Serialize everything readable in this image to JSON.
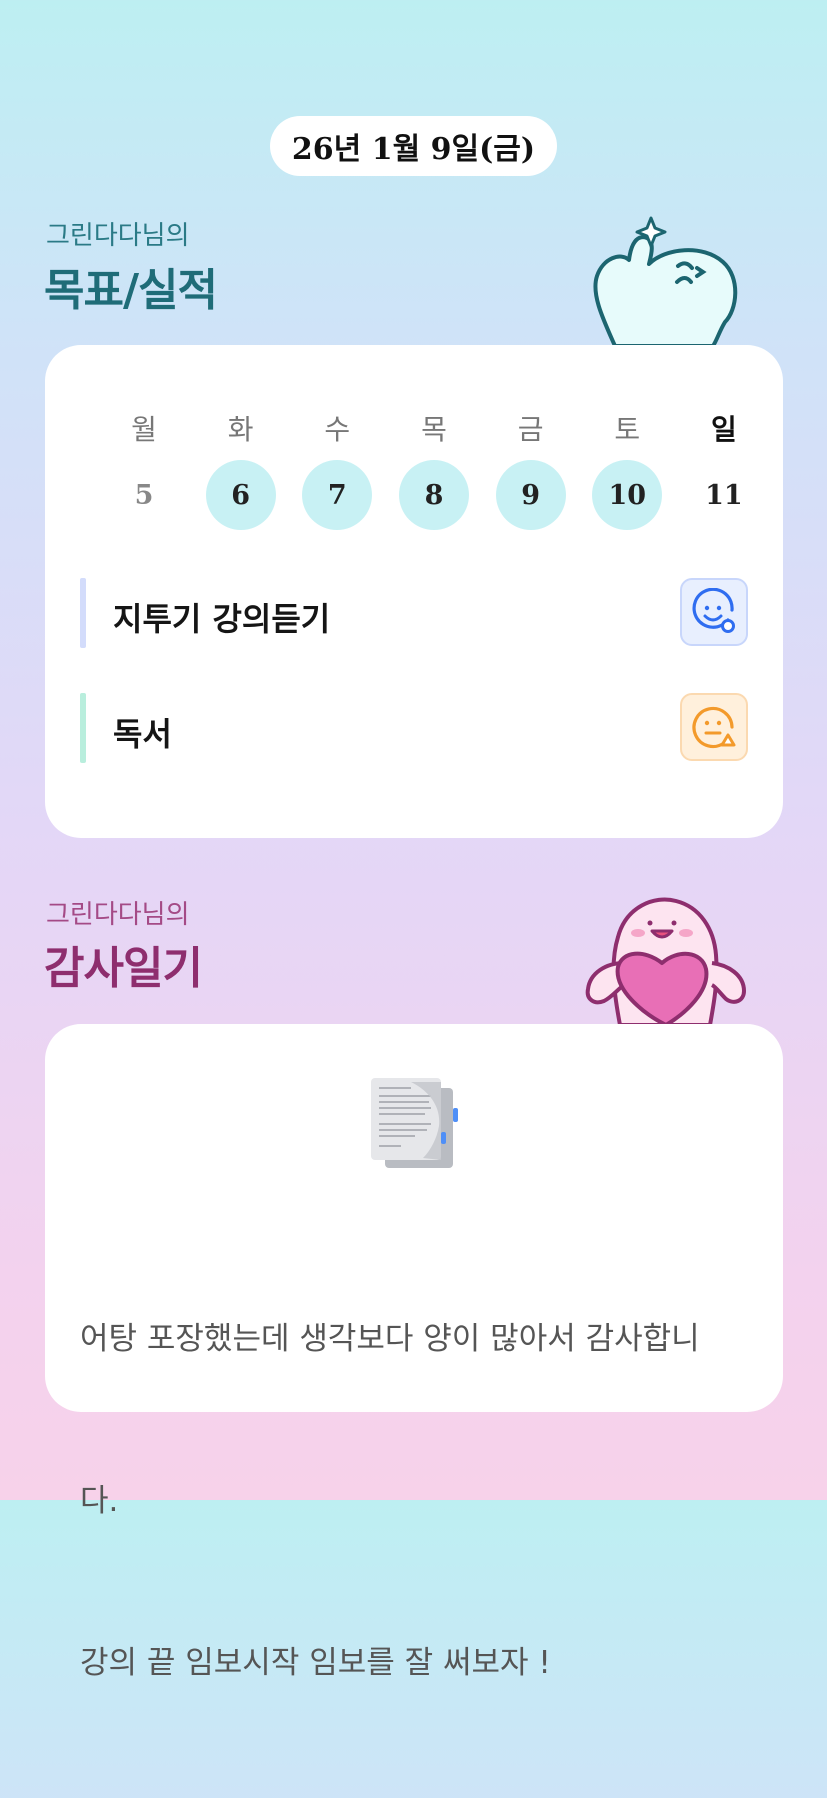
{
  "header": {
    "date": "26년 1월 9일(금)"
  },
  "goals_section": {
    "subtitle": "그린다다님의",
    "title": "목표/실적",
    "weekdays": [
      "월",
      "화",
      "수",
      "목",
      "금",
      "토",
      "일"
    ],
    "dates": [
      "5",
      "6",
      "7",
      "8",
      "9",
      "10",
      "11"
    ],
    "items": [
      {
        "label": "지투기 강의듣기",
        "status_icon": "smile-face-circle-icon",
        "accent": "#d3dcfb",
        "status_color": "#2f6df0"
      },
      {
        "label": "독서",
        "status_icon": "neutral-face-warning-icon",
        "accent": "#b9eedd",
        "status_color": "#f39a2b"
      }
    ]
  },
  "diary_section": {
    "subtitle": "그린다다님의",
    "title": "감사일기",
    "icon": "document-icon",
    "text_lines": [
      "어탕 포장했는데 생각보다 양이 많아서 감사합니",
      "다.",
      "강의 끝 임보시작 임보를 잘 써보자 !"
    ]
  },
  "colors": {
    "goal_title": "#1f6c78",
    "diary_title": "#8e2e6e",
    "date_highlight": "#c8f1f4"
  }
}
